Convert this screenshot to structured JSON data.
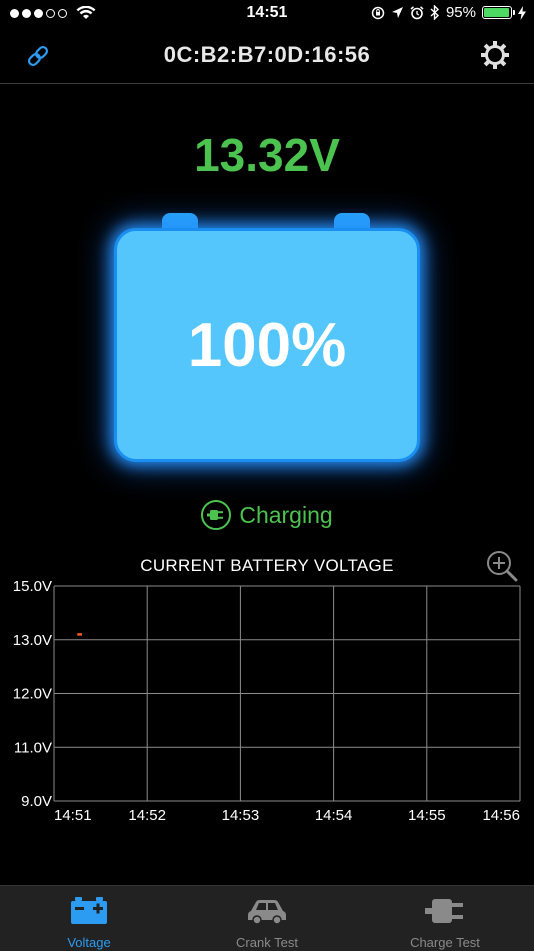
{
  "status_bar": {
    "time": "14:51",
    "battery_percent": "95%",
    "signal_dots_filled": 3,
    "signal_dots_total": 5
  },
  "nav": {
    "title": "0C:B2:B7:0D:16:56",
    "left_icon": "link-icon",
    "right_icon": "gear-icon"
  },
  "voltage": "13.32V",
  "battery": {
    "percent": "100%",
    "fill_level": 1.0
  },
  "status": {
    "label": "Charging",
    "icon": "plug-icon"
  },
  "colors": {
    "accent_green": "#4cc24f",
    "battery_blue": "#54c6fc",
    "active_tab": "#2c9cf2",
    "series_orange": "#ff5a1e"
  },
  "chart_data": {
    "type": "line",
    "title": "CURRENT BATTERY VOLTAGE",
    "x_tick_labels": [
      "14:51",
      "14:52",
      "14:53",
      "14:54",
      "14:55",
      "14:56"
    ],
    "y_tick_labels": [
      "15.0V",
      "13.0V",
      "12.0V",
      "11.0V",
      "9.0V"
    ],
    "y_tick_values": [
      15.0,
      13.0,
      12.0,
      11.0,
      9.0
    ],
    "series": [
      {
        "values": [
          {
            "x": "14:51:15",
            "y": 13.2
          },
          {
            "x": "14:51:18",
            "y": 13.2
          }
        ]
      }
    ],
    "grid": true
  },
  "zoom_icon": "zoom-in-icon",
  "tabs": [
    {
      "label": "Voltage",
      "icon": "battery-icon",
      "active": true
    },
    {
      "label": "Crank Test",
      "icon": "car-icon",
      "active": false
    },
    {
      "label": "Charge Test",
      "icon": "plug-icon",
      "active": false
    }
  ]
}
